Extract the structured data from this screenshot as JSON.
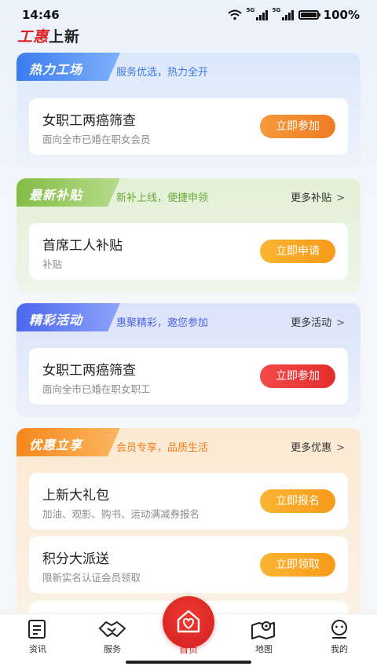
{
  "status_bar": {
    "time": "14:46",
    "network_1": "5G",
    "network_2": "5G",
    "battery": "100%",
    "battery_level": 1.0
  },
  "header": {
    "title_red": "工惠",
    "title_dark": "上新"
  },
  "sections": {
    "hot": {
      "badge": "热力工场",
      "subtitle": "服务优选，热力全开",
      "card": {
        "title": "女职工两癌筛查",
        "desc": "面向全市已婚在职女会员",
        "button": "立即参加"
      }
    },
    "subsidy": {
      "badge": "最新补贴",
      "subtitle": "新补上线，便捷申领",
      "more": "更多补贴",
      "card": {
        "title": "首席工人补贴",
        "desc": "补贴",
        "button": "立即申请"
      }
    },
    "activity": {
      "badge": "精彩活动",
      "subtitle": "惠聚精彩，邀您参加",
      "more": "更多活动",
      "card": {
        "title": "女职工两癌筛查",
        "desc": "面向全市已婚在职女职工",
        "button": "立即参加"
      }
    },
    "benefit": {
      "badge": "优惠立享",
      "subtitle": "会员专享，品质生活",
      "more": "更多优惠",
      "cards": [
        {
          "title": "上新大礼包",
          "desc": "加油、观影、购书、运动满减券报名",
          "button": "立即报名"
        },
        {
          "title": "积分大派送",
          "desc": "限新实名认证会员领取",
          "button": "立即领取"
        }
      ]
    }
  },
  "bottom_nav": {
    "items": [
      {
        "label": "资讯",
        "icon": "news-icon"
      },
      {
        "label": "服务",
        "icon": "handshake-icon"
      },
      {
        "label": "首页",
        "icon": "home-heart-icon"
      },
      {
        "label": "地图",
        "icon": "map-icon"
      },
      {
        "label": "我的",
        "icon": "profile-icon"
      }
    ]
  },
  "colors": {
    "brand_red": "#e02020",
    "hot_blue": "#3b7cf0",
    "subsidy_green": "#82bd45",
    "activity_indigo": "#4b67ee",
    "benefit_orange": "#f7871a"
  }
}
